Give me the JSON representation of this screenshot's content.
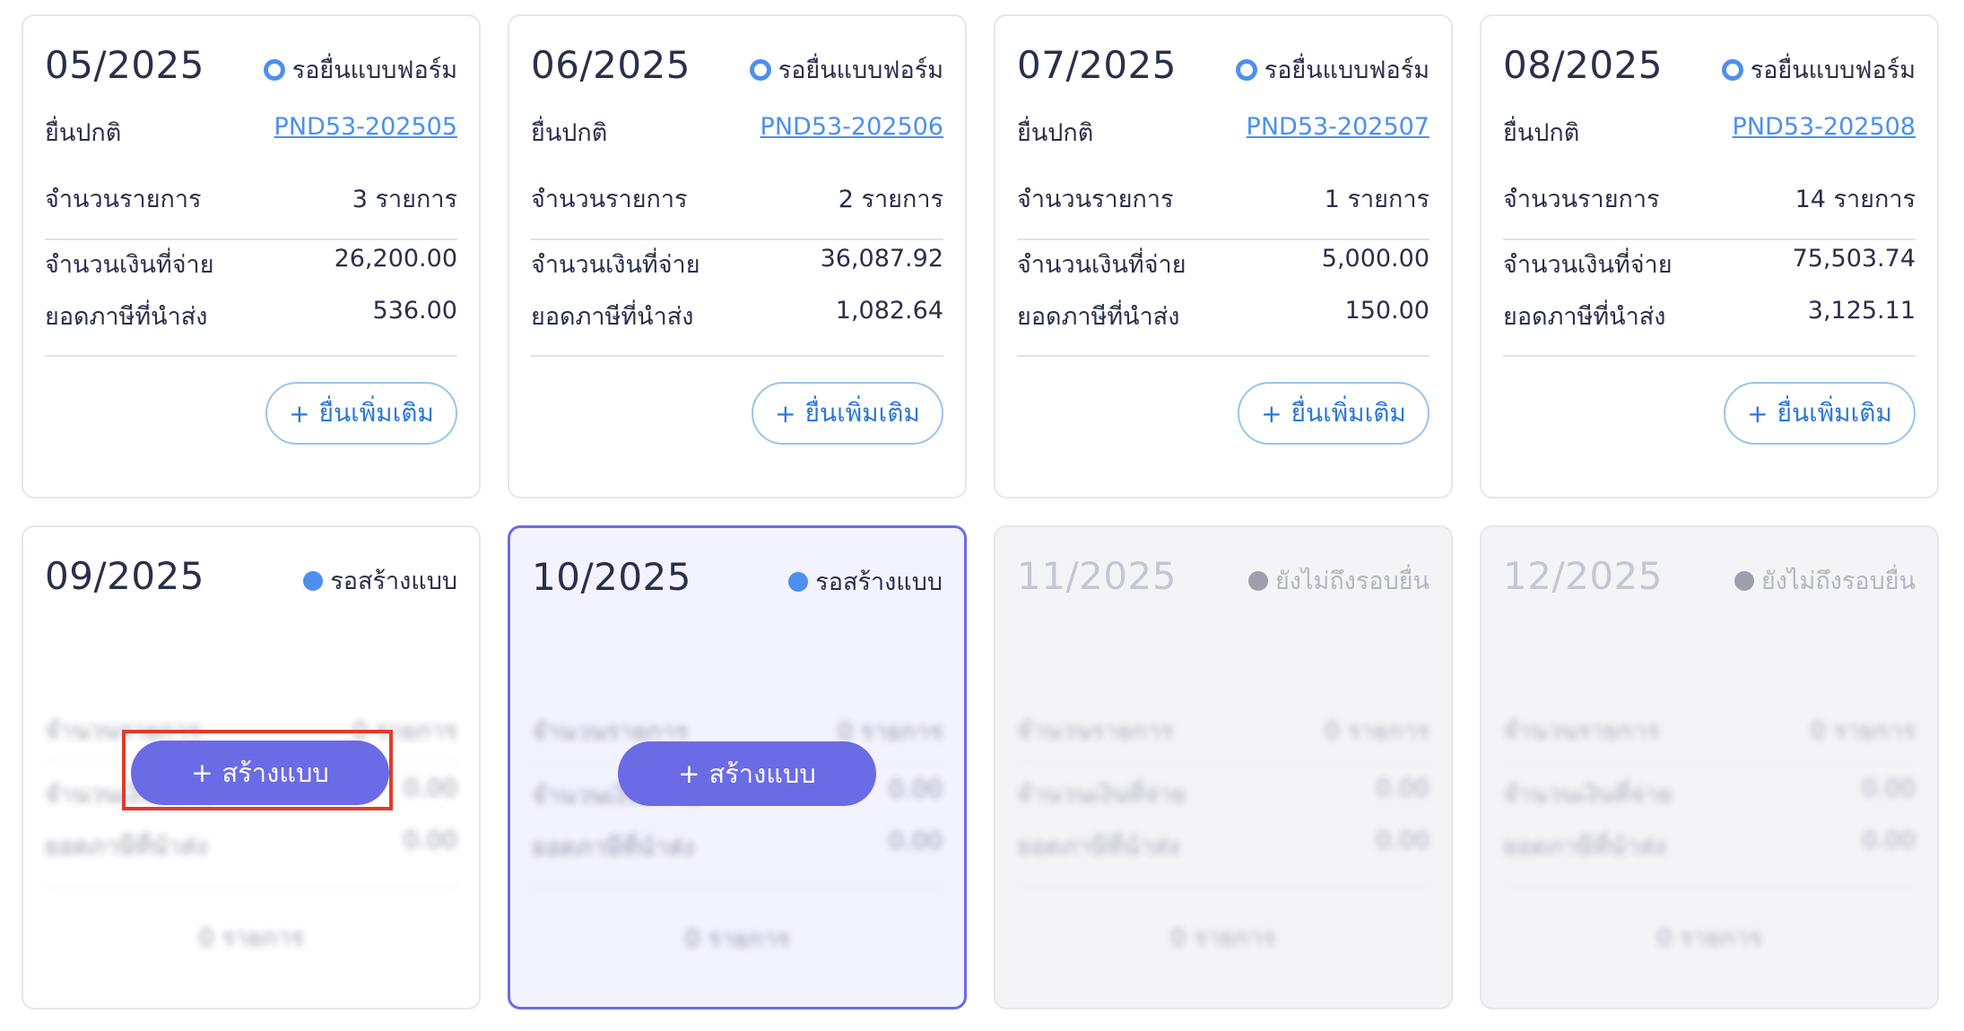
{
  "labels": {
    "normal_filing": "ยื่นปกติ",
    "count_label": "จำนวนรายการ",
    "paid_label": "จำนวนเงินที่จ่าย",
    "tax_label": "ยอดภาษีที่นำส่ง",
    "add_more_button": "ยื่นเพิ่มเติม",
    "create_button": "สร้างแบบ",
    "plus": "+"
  },
  "colors": {
    "accent": "#6b6be6",
    "link": "#4d8ff0",
    "highlight": "#e23a2a"
  },
  "filed_cards": [
    {
      "period": "05/2025",
      "status": "รอยื่นแบบฟอร์ม",
      "doc_no": "PND53-202505",
      "count": "3 รายการ",
      "paid": "26,200.00",
      "tax": "536.00"
    },
    {
      "period": "06/2025",
      "status": "รอยื่นแบบฟอร์ม",
      "doc_no": "PND53-202506",
      "count": "2 รายการ",
      "paid": "36,087.92",
      "tax": "1,082.64"
    },
    {
      "period": "07/2025",
      "status": "รอยื่นแบบฟอร์ม",
      "doc_no": "PND53-202507",
      "count": "1 รายการ",
      "paid": "5,000.00",
      "tax": "150.00"
    },
    {
      "period": "08/2025",
      "status": "รอยื่นแบบฟอร์ม",
      "doc_no": "PND53-202508",
      "count": "14 รายการ",
      "paid": "75,503.74",
      "tax": "3,125.11"
    }
  ],
  "pending_cards": [
    {
      "period": "09/2025",
      "status": "รอสร้างแบบ",
      "count": "0 รายการ",
      "paid": "0.00",
      "tax": "0.00",
      "footer": "0 รายการ"
    },
    {
      "period": "10/2025",
      "status": "รอสร้างแบบ",
      "count": "0 รายการ",
      "paid": "0.00",
      "tax": "0.00",
      "footer": "0 รายการ"
    }
  ],
  "future_cards": [
    {
      "period": "11/2025",
      "status": "ยังไม่ถึงรอบยื่น",
      "count": "0 รายการ",
      "paid": "0.00",
      "tax": "0.00",
      "footer": "0 รายการ"
    },
    {
      "period": "12/2025",
      "status": "ยังไม่ถึงรอบยื่น",
      "count": "0 รายการ",
      "paid": "0.00",
      "tax": "0.00",
      "footer": "0 รายการ"
    }
  ]
}
